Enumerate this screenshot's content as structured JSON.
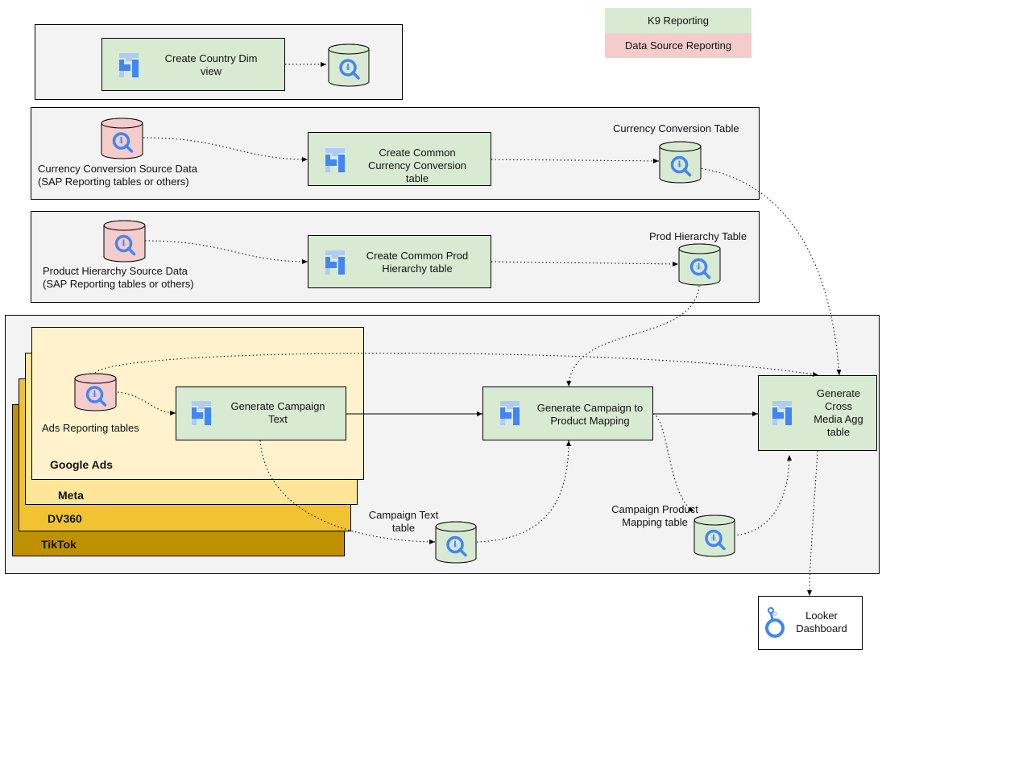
{
  "legend": {
    "items": [
      {
        "label": "K9 Reporting",
        "color": "#d9ead3"
      },
      {
        "label": "Data Source Reporting",
        "color": "#f4cccc"
      }
    ]
  },
  "colors": {
    "k9": "#d9ead3",
    "source": "#f4cccc",
    "group_bg": "#f3f3f3",
    "google_ads": "#fff2cc",
    "meta": "#ffe599",
    "dv360": "#f1c232",
    "tiktok": "#bf9000"
  },
  "country_group": {
    "process": "Create Country Dim view"
  },
  "currency_group": {
    "source_label_line1": "Currency Conversion Source Data",
    "source_label_line2": "(SAP Reporting tables or others)",
    "process": "Create Common Currency Conversion table",
    "table_label": "Currency Conversion Table"
  },
  "product_group": {
    "source_label_line1": "Product Hierarchy Source Data",
    "source_label_line2": "(SAP Reporting tables or others)",
    "process": "Create Common Prod Hierarchy table",
    "table_label": "Prod Hierarchy Table"
  },
  "ads_group": {
    "platforms": [
      "Google Ads",
      "Meta",
      "DV360",
      "TikTok"
    ],
    "source_label": "Ads Reporting tables",
    "process_campaign_text": "Generate Campaign Text",
    "campaign_text_table": "Campaign Text table",
    "process_mapping": "Generate Campaign to Product Mapping",
    "mapping_table": "Campaign Product Mapping table",
    "process_cross_media": "Generate Cross Media Agg table"
  },
  "output": {
    "dashboard": "Looker Dashboard"
  },
  "icons": {
    "process": "dataform-icon",
    "table": "bigquery-icon",
    "dashboard": "looker-icon"
  }
}
